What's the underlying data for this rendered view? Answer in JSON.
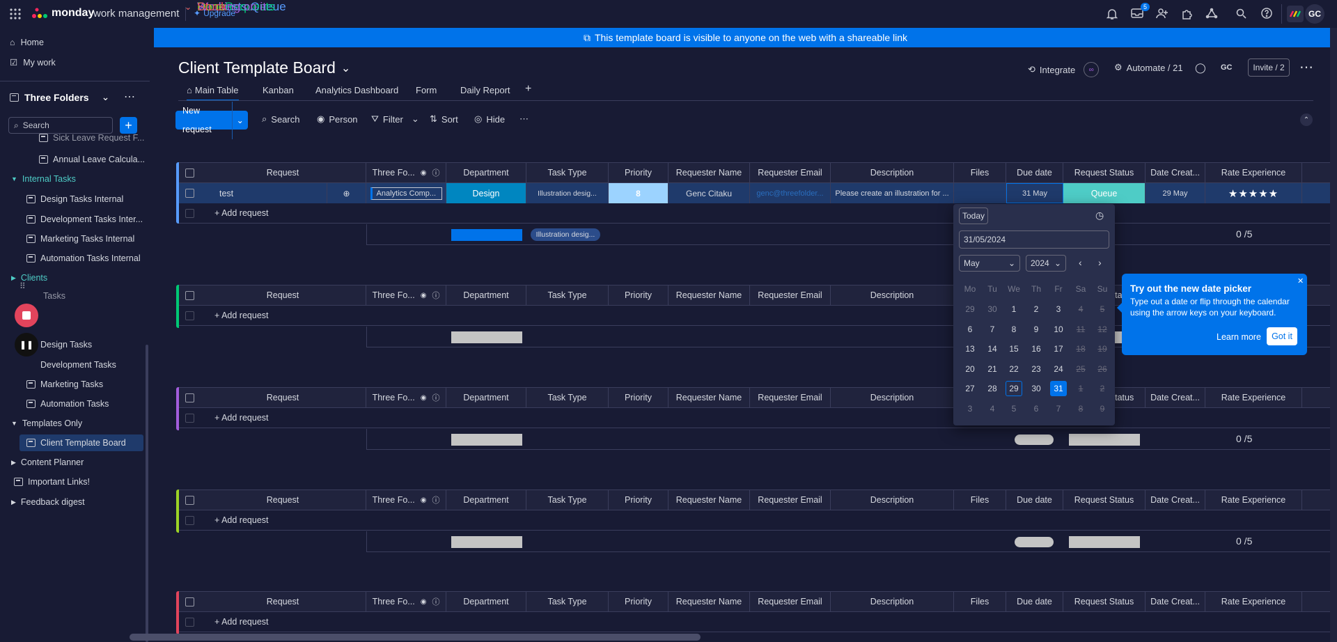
{
  "app": {
    "brand": "monday",
    "brand_suffix": "work management",
    "upgrade": "Upgrade",
    "inbox_count": "5",
    "avatar": "GC"
  },
  "banner": {
    "text": "This template board is visible to anyone on the web with a shareable link"
  },
  "sidebar": {
    "home": "Home",
    "my_work": "My work",
    "workspace": "Three Folders",
    "search_placeholder": "Search",
    "items": [
      {
        "label": "Sick Leave Request F..."
      },
      {
        "label": "Annual Leave Calcula..."
      },
      {
        "label": "Internal Tasks"
      },
      {
        "label": "Design Tasks Internal"
      },
      {
        "label": "Development Tasks Inter..."
      },
      {
        "label": "Marketing Tasks Internal"
      },
      {
        "label": "Automation Tasks Internal"
      },
      {
        "label": "Clients"
      },
      {
        "label": "Tasks"
      },
      {
        "label": "Design Tasks"
      },
      {
        "label": "Development Tasks"
      },
      {
        "label": "Marketing Tasks"
      },
      {
        "label": "Automation Tasks"
      },
      {
        "label": "Templates Only"
      },
      {
        "label": "Client Template Board"
      },
      {
        "label": "Content Planner"
      },
      {
        "label": "Important Links!"
      },
      {
        "label": "Feedback digest"
      }
    ]
  },
  "board": {
    "title": "Client Template Board",
    "integrate": "Integrate",
    "automate": "Automate / 21",
    "user_initials": "GC",
    "invite": "Invite / 2",
    "tabs": [
      "Main Table",
      "Kanban",
      "Analytics Dashboard",
      "Form",
      "Daily Report"
    ],
    "toolbar": {
      "new": "New request",
      "search": "Search",
      "person": "Person",
      "filter": "Filter",
      "sort": "Sort",
      "hide": "Hide"
    },
    "columns": [
      "Request",
      "Three Fo...",
      "Department",
      "Task Type",
      "Priority",
      "Requester Name",
      "Requester Email",
      "Description",
      "Files",
      "Due date",
      "Request Status",
      "Date Creat...",
      "Rate Experience"
    ],
    "add_request": "+ Add request",
    "groups": [
      {
        "name": "Requests Queue",
        "color": "#579bfc"
      },
      {
        "name": "Sent Requests",
        "color": "#00c875"
      },
      {
        "name": "Working on it",
        "color": "#a25ddc"
      },
      {
        "name": "Done",
        "color": "#9cd326"
      },
      {
        "name": "Stuck",
        "color": "#e2445c"
      }
    ],
    "row": {
      "name": "test",
      "three": "Analytics Comp...",
      "department": "Design",
      "task_type": "Illustration desig...",
      "priority": "8",
      "requester": "Genc Citaku",
      "email": "genc@threefolder...",
      "description": "Please create an illustration for ...",
      "due": "31 May",
      "status": "Queue",
      "created": "29 May",
      "rating": "★★★★★"
    },
    "summary": {
      "task_type": "Illustration desig...",
      "rate": "0 /5"
    }
  },
  "datepicker": {
    "today": "Today",
    "input": "31/05/2024",
    "month": "May",
    "year": "2024",
    "weekdays": [
      "Mo",
      "Tu",
      "We",
      "Th",
      "Fr",
      "Sa",
      "Su"
    ],
    "weeks": [
      [
        "29",
        "30",
        "1",
        "2",
        "3",
        "4",
        "5"
      ],
      [
        "6",
        "7",
        "8",
        "9",
        "10",
        "11",
        "12"
      ],
      [
        "13",
        "14",
        "15",
        "16",
        "17",
        "18",
        "19"
      ],
      [
        "20",
        "21",
        "22",
        "23",
        "24",
        "25",
        "26"
      ],
      [
        "27",
        "28",
        "29",
        "30",
        "31",
        "1",
        "2"
      ],
      [
        "3",
        "4",
        "5",
        "6",
        "7",
        "8",
        "9"
      ]
    ]
  },
  "tooltip": {
    "title": "Try out the new date picker",
    "body": "Type out a date or flip through the calendar using the arrow keys on your keyboard.",
    "learn": "Learn more",
    "ok": "Got it"
  },
  "colors": {
    "bg": "#181b34",
    "primary": "#0073ea",
    "design": "#0086c0",
    "queue": "#4eccc6"
  }
}
